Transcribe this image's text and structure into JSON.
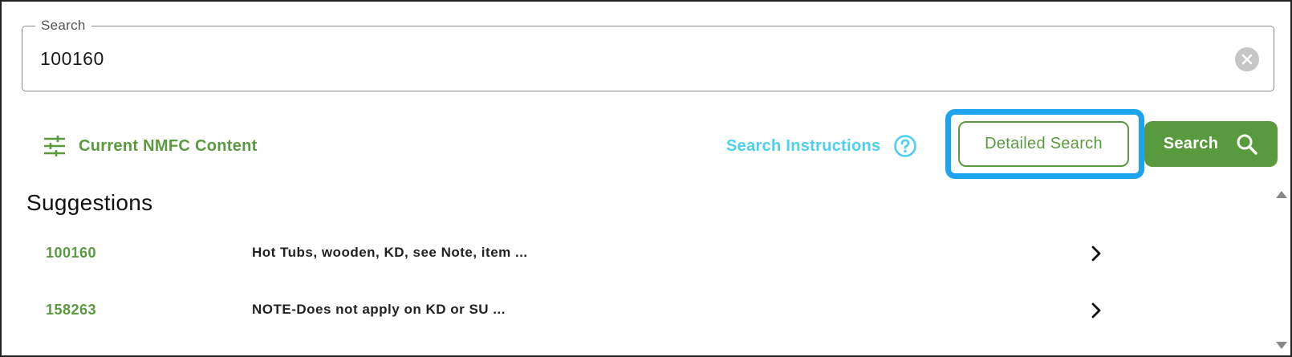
{
  "search": {
    "legend": "Search",
    "value": "100160"
  },
  "toolbar": {
    "nmfc_label": "Current NMFC Content",
    "nmfc_icon": "sliders-icon",
    "instructions_label": "Search Instructions",
    "instructions_icon": "help-circle-icon",
    "detailed_search_label": "Detailed Search",
    "search_label": "Search",
    "search_icon": "search-icon"
  },
  "suggestions": {
    "title": "Suggestions",
    "items": [
      {
        "code": "100160",
        "description": "Hot Tubs, wooden, KD, see Note, item ..."
      },
      {
        "code": "158263",
        "description": "NOTE-Does not apply on KD or SU ..."
      }
    ]
  },
  "colors": {
    "brand_green": "#5a9a3e",
    "link_cyan": "#4dd0f0",
    "highlight_blue": "#1ea4ee"
  }
}
